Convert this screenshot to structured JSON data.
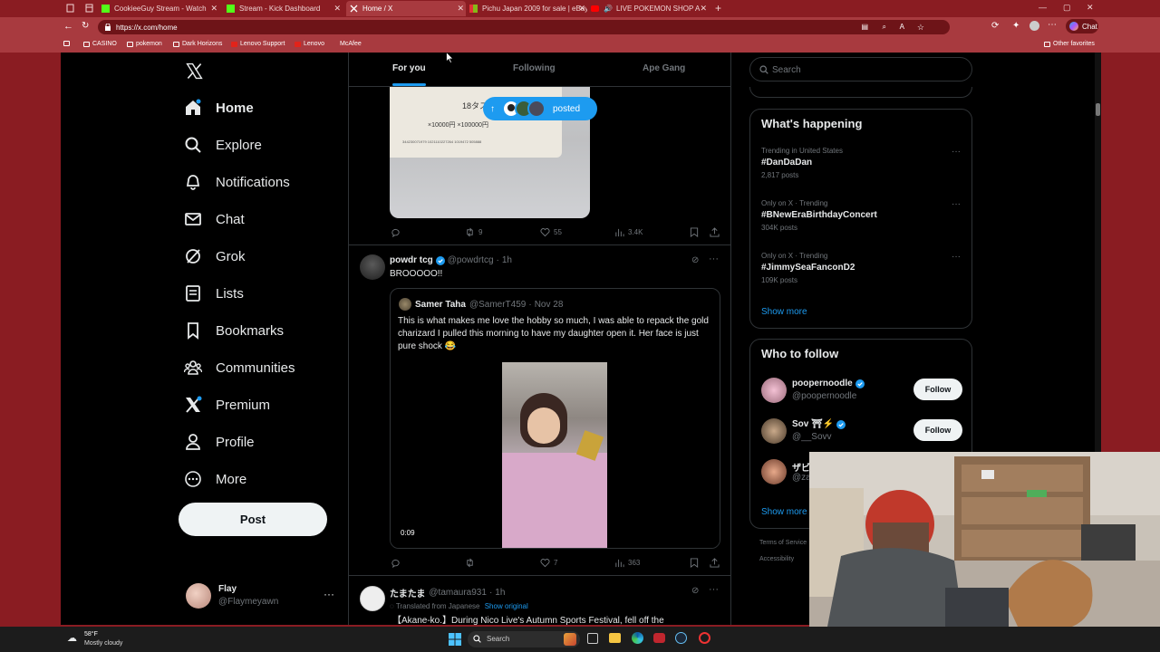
{
  "browser": {
    "tabs": [
      {
        "title": "CookieeGuy Stream - Watch",
        "active": false
      },
      {
        "title": "Stream - Kick Dashboard",
        "active": false
      },
      {
        "title": "Home / X",
        "active": true
      },
      {
        "title": "Pichu Japan 2009 for sale | eBay",
        "active": false
      },
      {
        "title": "LIVE POKEMON SHOP A",
        "active": false
      }
    ],
    "url": "https://x.com/home",
    "favorites": [
      "CASINO",
      "pokemon",
      "Dark Horizons",
      "Lenovo Support",
      "Lenovo",
      "McAfee"
    ],
    "other_favorites": "Other favorites",
    "chat_label": "Chat"
  },
  "sidebar": {
    "items": [
      {
        "label": "Home",
        "icon": "home-icon",
        "bold": true
      },
      {
        "label": "Explore",
        "icon": "search-icon"
      },
      {
        "label": "Notifications",
        "icon": "bell-icon"
      },
      {
        "label": "Chat",
        "icon": "mail-icon"
      },
      {
        "label": "Grok",
        "icon": "grok-icon"
      },
      {
        "label": "Lists",
        "icon": "list-icon"
      },
      {
        "label": "Bookmarks",
        "icon": "bookmark-icon"
      },
      {
        "label": "Communities",
        "icon": "people-icon"
      },
      {
        "label": "Premium",
        "icon": "x-logo-icon"
      },
      {
        "label": "Profile",
        "icon": "person-icon"
      },
      {
        "label": "More",
        "icon": "more-circle-icon"
      }
    ],
    "post_label": "Post",
    "account": {
      "name": "Flay",
      "handle": "@Flaymeyawn"
    }
  },
  "feed": {
    "tabs": [
      "For you",
      "Following",
      "Ape Gang"
    ],
    "posted_pill": "posted",
    "first_stats": {
      "retweets": "9",
      "likes": "55",
      "views": "3.4K"
    },
    "ticket_text": {
      "race": "18タステ",
      "amount": "×10000円 ×100000円",
      "serial": "344230071979 1021110227264 1019472 505888"
    },
    "tweet2": {
      "name": "powdr tcg",
      "handle": "@powdrtcg",
      "time": "1h",
      "text": "BROOOOO!!",
      "quote": {
        "name": "Samer Taha",
        "handle": "@SamerT459",
        "date": "Nov 28",
        "text": "This is what makes me love the hobby so much, I was able to repack the gold charizard I pulled this morning to have my daughter open it.  Her face is just pure shock 😂",
        "video_time": "0:09"
      },
      "stats": {
        "retweets": "",
        "likes": "7",
        "views": "363"
      }
    },
    "tweet3": {
      "name": "たまたま",
      "handle": "@tamaura931",
      "time": "1h",
      "translated": "Translated from Japanese",
      "show_original": "Show original",
      "text": "【Akane-ko.】During Nico Live's Autumn Sports Festival, fell off the"
    }
  },
  "right": {
    "search_placeholder": "Search",
    "happening_title": "What's happening",
    "trends": [
      {
        "category": "Trending in United States",
        "tag": "#DanDaDan",
        "count": "2,817 posts"
      },
      {
        "category": "Only on X · Trending",
        "tag": "#BNewEraBirthdayConcert",
        "count": "304K posts"
      },
      {
        "category": "Only on X · Trending",
        "tag": "#JimmySeaFanconD2",
        "count": "109K posts"
      }
    ],
    "show_more": "Show more",
    "who_title": "Who to follow",
    "follow": [
      {
        "name": "poopernoodle",
        "handle": "@poopernoodle",
        "verified": true
      },
      {
        "name": "Sov ⛩⚡",
        "handle": "@__Sovv",
        "verified": true
      },
      {
        "name": "ザビ",
        "handle": "@za",
        "verified": false
      }
    ],
    "follow_label": "Follow",
    "footer": [
      "Terms of Service",
      "Accessibility"
    ]
  },
  "taskbar": {
    "temp": "58°F",
    "weather": "Mostly cloudy",
    "search": "Search"
  },
  "colors": {
    "accent": "#1d9bf0",
    "browser": "#8a1c22"
  }
}
